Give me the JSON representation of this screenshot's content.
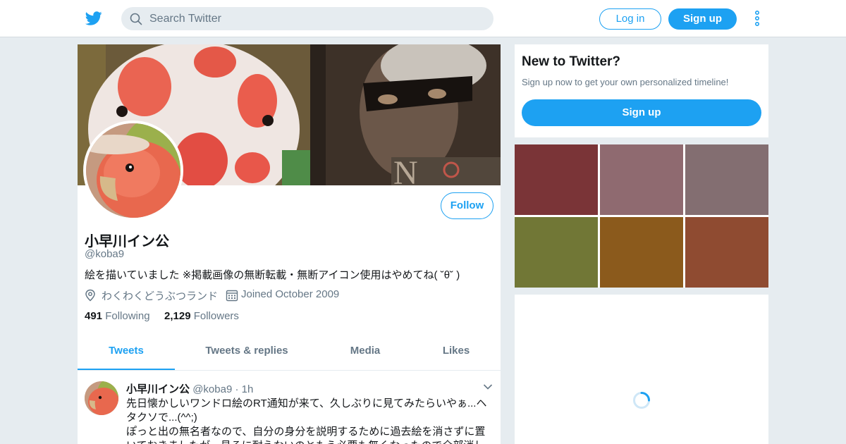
{
  "header": {
    "search_placeholder": "Search Twitter",
    "login_label": "Log in",
    "signup_label": "Sign up",
    "brand_color": "#1da1f2"
  },
  "profile": {
    "display_name": "小早川イン公",
    "handle": "@koba9",
    "bio": "絵を描いていました ※掲載画像の無断転載・無断アイコン使用はやめてね( ˘θ˘ )",
    "location": "わくわくどうぶつランド",
    "joined": "Joined October 2009",
    "follow_label": "Follow",
    "following_count": "491",
    "following_label": "Following",
    "followers_count": "2,129",
    "followers_label": "Followers"
  },
  "tabs": [
    {
      "label": "Tweets",
      "active": true
    },
    {
      "label": "Tweets & replies",
      "active": false
    },
    {
      "label": "Media",
      "active": false
    },
    {
      "label": "Likes",
      "active": false
    }
  ],
  "tweet": {
    "name": "小早川イン公",
    "handle": "@koba9",
    "separator": "·",
    "time": "1h",
    "line1": "先日懐かしいワンドロ絵のRT通知が来て、久しぶりに見てみたらいやぁ...ヘタクソで...(^^;)",
    "line2": "ぽっと出の無名者なので、自分の身分を説明するために過去絵を消さずに置いておきましたが、見るに耐えないのともう必要も無くなったので全部消し"
  },
  "sidebar": {
    "signup_title": "New to Twitter?",
    "signup_sub": "Sign up now to get your own personalized timeline!",
    "signup_button": "Sign up"
  },
  "media_tiles": [
    {
      "color": "#7a3437"
    },
    {
      "color": "#8f6a70"
    },
    {
      "color": "#836e71"
    },
    {
      "color": "#717736"
    },
    {
      "color": "#8b5a1c"
    },
    {
      "color": "#8f4b31"
    }
  ]
}
